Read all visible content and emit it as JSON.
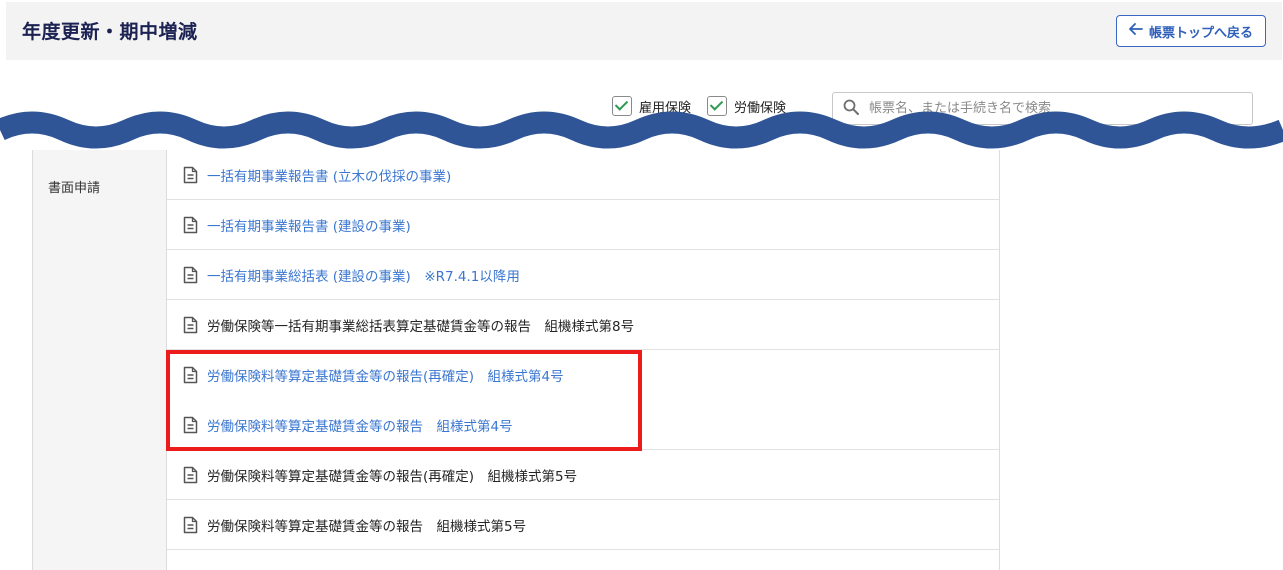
{
  "header": {
    "title": "年度更新・期中増減",
    "back_label": "帳票トップへ戻る"
  },
  "filters": {
    "employment_insurance": "雇用保険",
    "labor_insurance": "労働保険"
  },
  "search": {
    "placeholder": "帳票名、または手続き名で検索"
  },
  "category": {
    "label": "書面申請"
  },
  "rows": [
    {
      "label": "一括有期事業報告書 (立木の伐採の事業)",
      "link": true
    },
    {
      "label": "一括有期事業報告書 (建設の事業)",
      "link": true
    },
    {
      "label": "一括有期事業総括表 (建設の事業)　※R7.4.1以降用",
      "link": true
    },
    {
      "label": "労働保険等一括有期事業総括表算定基礎賃金等の報告　組機様式第8号",
      "link": false
    },
    {
      "label": "労働保険料等算定基礎賃金等の報告(再確定)　組様式第4号",
      "link": true
    },
    {
      "label": "労働保険料等算定基礎賃金等の報告　組様式第4号",
      "link": true
    },
    {
      "label": "労働保険料等算定基礎賃金等の報告(再確定)　組機様式第5号",
      "link": false
    },
    {
      "label": "労働保険料等算定基礎賃金等の報告　組機様式第5号",
      "link": false
    }
  ],
  "colors": {
    "title": "#1b2252",
    "link": "#3b77d0",
    "highlight": "#ec1c1c",
    "wave": "#2f5597"
  }
}
